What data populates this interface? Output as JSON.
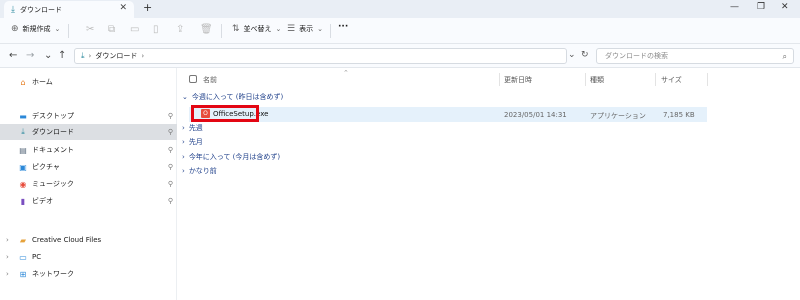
{
  "window": {
    "tab_title": "ダウンロード",
    "tab_icon": "download-icon",
    "close_glyph": "✕",
    "newtab_glyph": "+",
    "controls": {
      "minimize": "—",
      "maximize": "❐",
      "close": "✕"
    }
  },
  "toolbar": {
    "new_label": "新規作成",
    "sort_label": "並べ替え",
    "view_label": "表示",
    "more_label": "···"
  },
  "address": {
    "segment": "ダウンロード",
    "search_placeholder": "ダウンロードの検索"
  },
  "sidebar": {
    "home": "ホーム",
    "quick_access": [
      {
        "label": "デスクトップ",
        "icon": "desktop-icon",
        "color": "#2b88d8"
      },
      {
        "label": "ダウンロード",
        "icon": "download-icon",
        "color": "#2d8a9e"
      },
      {
        "label": "ドキュメント",
        "icon": "documents-icon",
        "color": "#5a6b7e"
      },
      {
        "label": "ピクチャ",
        "icon": "pictures-icon",
        "color": "#2b88d8"
      },
      {
        "label": "ミュージック",
        "icon": "music-icon",
        "color": "#e74c3c"
      },
      {
        "label": "ビデオ",
        "icon": "videos-icon",
        "color": "#7a4ec0"
      }
    ],
    "tree": [
      {
        "label": "Creative Cloud Files",
        "icon": "creative-cloud-icon"
      },
      {
        "label": "PC",
        "icon": "pc-icon"
      },
      {
        "label": "ネットワーク",
        "icon": "network-icon"
      }
    ]
  },
  "columns": {
    "name": "名前",
    "modified": "更新日時",
    "type": "種類",
    "size": "サイズ"
  },
  "groups": {
    "this_week": "今週に入って (昨日は含めず)",
    "last_week": "先週",
    "last_month": "先月",
    "this_year": "今年に入って (今月は含めず)",
    "long_ago": "かなり前"
  },
  "file": {
    "name": "OfficeSetup.exe",
    "modified": "2023/05/01 14:31",
    "type": "アプリケーション",
    "size": "7,185 KB"
  },
  "accent_colors": {
    "highlight_box": "#e30613",
    "selected_row": "#e5f1fb",
    "group_header": "#1e3f8a"
  }
}
